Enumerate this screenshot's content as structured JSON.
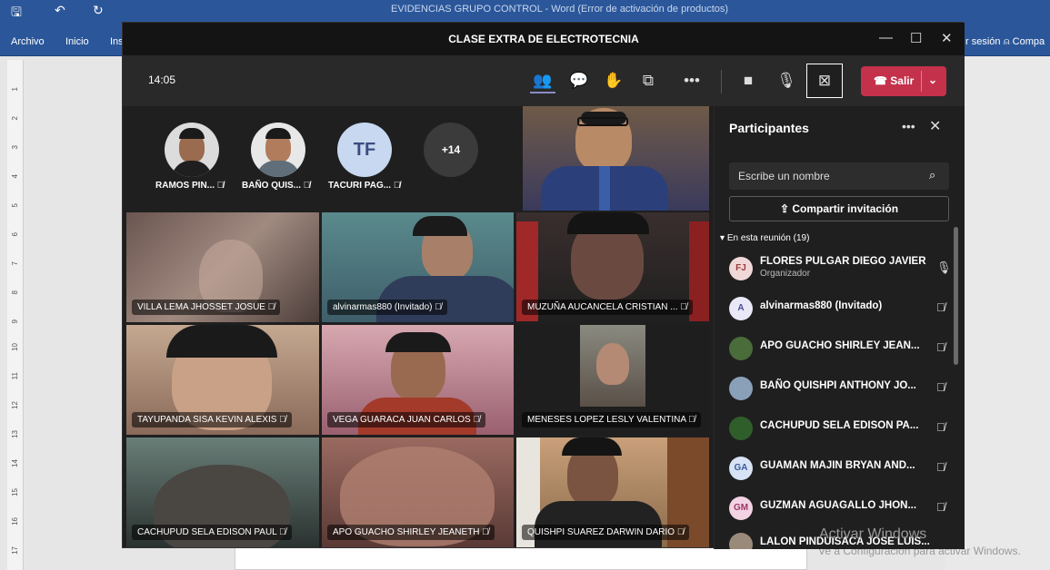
{
  "word": {
    "title": "EVIDENCIAS GRUPO CONTROL - Word (Error de activación de productos)",
    "tabs": [
      "Archivo",
      "Inicio",
      "Ins"
    ],
    "right_items": [
      "r sesión",
      "Compa"
    ],
    "ruler_marks": [
      "1",
      "2",
      "3",
      "4",
      "5",
      "6",
      "7",
      "8",
      "9",
      "10",
      "11",
      "12",
      "13",
      "14",
      "15",
      "16",
      "17"
    ],
    "watermark_line2": "Ve a Configuración para activar Windows."
  },
  "teams": {
    "window_title": "CLASE EXTRA DE ELECTROTECNIA",
    "time": "14:05",
    "leave_label": "Salir",
    "overflow_count": "+14",
    "top_avatars": [
      {
        "name": "RAMOS PIN...",
        "initials": ""
      },
      {
        "name": "BAÑO QUIS...",
        "initials": ""
      },
      {
        "name": "TACURI PAG...",
        "initials": "TF"
      }
    ],
    "tiles": [
      {
        "name": "VILLA LEMA JHOSSET JOSUE"
      },
      {
        "name": "alvinarmas880 (Invitado)"
      },
      {
        "name": "MUZUÑA AUCANCELA CRISTIAN ..."
      },
      {
        "name": "TAYUPANDA SISA KEVIN ALEXIS"
      },
      {
        "name": "VEGA GUARACA JUAN CARLOS"
      },
      {
        "name": "MENESES LOPEZ LESLY VALENTINA"
      },
      {
        "name": "CACHUPUD SELA EDISON PAUL"
      },
      {
        "name": "APO GUACHO SHIRLEY JEANETH"
      },
      {
        "name": "QUISHPI SUAREZ DARWIN DARIO"
      }
    ],
    "panel": {
      "title": "Participantes",
      "search_placeholder": "Escribe un nombre",
      "share_label": "Compartir invitación",
      "section_label": "En esta reunión (19)",
      "participants": [
        {
          "name": "FLORES PULGAR DIEGO JAVIER",
          "role": "Organizador",
          "initials": "FJ",
          "avatar_color": "#f1d8d8"
        },
        {
          "name": "alvinarmas880 (Invitado)",
          "role": "",
          "initials": "A",
          "avatar_color": "#e8e8f6"
        },
        {
          "name": "APO GUACHO SHIRLEY JEAN...",
          "role": "",
          "initials": "",
          "avatar_color": "#4a6b3a"
        },
        {
          "name": "BAÑO QUISHPI ANTHONY JO...",
          "role": "",
          "initials": "",
          "avatar_color": "#8aa0b8"
        },
        {
          "name": "CACHUPUD SELA EDISON PA...",
          "role": "",
          "initials": "",
          "avatar_color": "#2f5e2a"
        },
        {
          "name": "GUAMAN MAJIN BRYAN AND...",
          "role": "",
          "initials": "GA",
          "avatar_color": "#d7e3f5"
        },
        {
          "name": "GUZMAN AGUAGALLO JHON...",
          "role": "",
          "initials": "GM",
          "avatar_color": "#f3d3e3"
        },
        {
          "name": "LALON PINDUISACA JOSE LUIS...",
          "role": "",
          "initials": "",
          "avatar_color": "#9a8a7a"
        }
      ]
    },
    "watermark": "Activar Windows"
  },
  "colors": {
    "leave": "#c4314b",
    "panel_bg": "#1f1f1f",
    "word_blue": "#2b579a"
  },
  "icons": [
    "save-icon",
    "undo-icon",
    "redo-icon",
    "people-icon",
    "chat-icon",
    "reactions-icon",
    "rooms-icon",
    "more-icon",
    "camera-icon",
    "mic-icon",
    "share-screen-icon",
    "phone-icon",
    "search-icon",
    "share-icon",
    "mic-off-icon"
  ]
}
